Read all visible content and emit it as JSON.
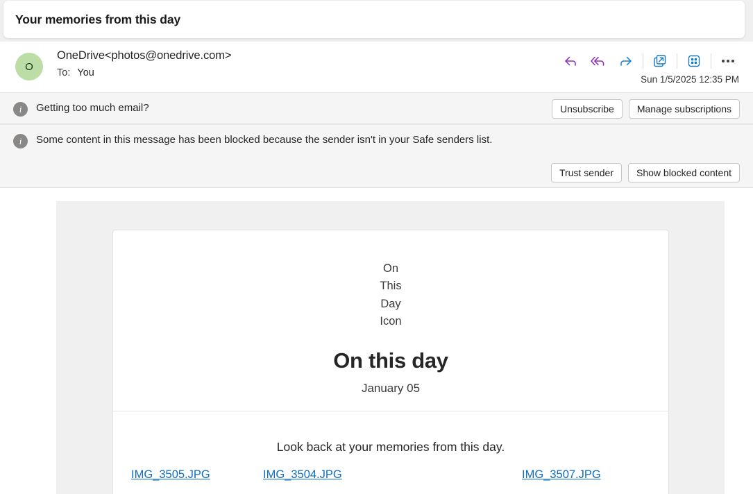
{
  "subject": {
    "title": "Your memories from this day"
  },
  "message": {
    "avatar_initial": "O",
    "sender": "OneDrive<photos@onedrive.com>",
    "to_label": "To:",
    "to_value": "You",
    "timestamp": "Sun 1/5/2025 12:35 PM"
  },
  "actions": {
    "reply": "reply-icon",
    "reply_all": "reply-all-icon",
    "forward": "forward-icon",
    "pop_out": "pop-out-icon",
    "apps": "apps-grid-icon",
    "more": "more-options-icon"
  },
  "banners": [
    {
      "icon": "info-icon",
      "text": "Getting too much email?",
      "buttons": [
        "Unsubscribe",
        "Manage subscriptions"
      ]
    },
    {
      "icon": "info-icon",
      "text": "Some content in this message has been blocked because the sender isn't in your Safe senders list.",
      "buttons": [
        "Trust sender",
        "Show blocked content"
      ]
    }
  ],
  "email_body": {
    "blocked_image_alt": "On\nThis\nDay\nIcon",
    "headline": "On this day",
    "subhead": "January 05",
    "lookback_text": "Look back at your memories from this day.",
    "image_links": [
      "IMG_3505.JPG",
      "IMG_3504.JPG",
      "IMG_3507.JPG"
    ]
  },
  "colors": {
    "reply_purple": "#8b2bb0",
    "forward_blue": "#1a7fd4",
    "icon_blue": "#1679bd",
    "link_blue": "#0f6cbd",
    "avatar_bg": "#bcdda5",
    "banner_bg": "#f5f5f5",
    "panel_gray": "#f0f0f0"
  }
}
